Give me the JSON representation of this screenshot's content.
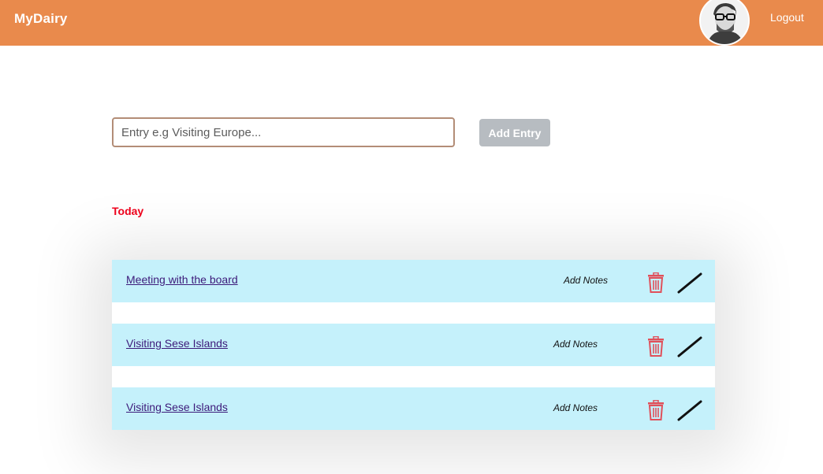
{
  "navbar": {
    "brand": "MyDairy",
    "avatar_icon": "user-avatar-icon",
    "logout_label": "Logout",
    "background_color": "#e98a4c"
  },
  "entry_form": {
    "placeholder": "Entry e.g Visiting Europe...",
    "value": "",
    "add_button_label": "Add Entry"
  },
  "section": {
    "title": "Today",
    "title_color": "#f0001c"
  },
  "entries": [
    {
      "title": "Meeting with the board",
      "notes_label": "Add Notes",
      "delete_icon": "trash-icon",
      "edit_icon": "pen-icon"
    },
    {
      "title": "Visiting Sese Islands",
      "notes_label": "Add Notes",
      "delete_icon": "trash-icon",
      "edit_icon": "pen-icon"
    },
    {
      "title": "Visiting Sese Islands",
      "notes_label": "Add Notes",
      "delete_icon": "trash-icon",
      "edit_icon": "pen-icon"
    }
  ],
  "colors": {
    "row_background": "#c5f1fb",
    "trash": "#e0505a",
    "link": "#3c1a7a"
  }
}
